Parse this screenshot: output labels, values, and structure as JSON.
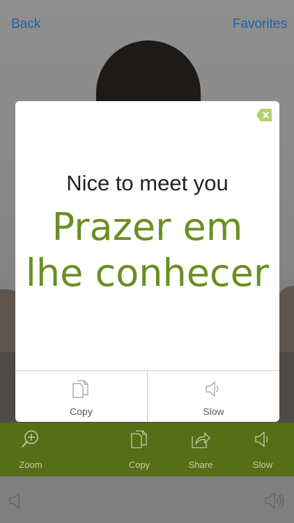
{
  "nav": {
    "back_label": "Back",
    "favorites_label": "Favorites"
  },
  "card": {
    "english": "Nice to meet you",
    "portuguese": "Prazer em lhe conhecer",
    "actions": [
      {
        "label": "Copy",
        "icon": "copy-icon"
      },
      {
        "label": "Slow",
        "icon": "speaker-icon"
      }
    ],
    "close_icon": "close-icon",
    "accent_color": "#6b8e23"
  },
  "toolbar": {
    "color": "#566e16",
    "items": [
      {
        "label": "Zoom",
        "icon": "zoom-in-icon"
      },
      {
        "label": "Copy",
        "icon": "copy-icon"
      },
      {
        "label": "Share",
        "icon": "share-icon"
      },
      {
        "label": "Slow",
        "icon": "speaker-icon"
      }
    ]
  },
  "player": {
    "left_icon": "volume-low-icon",
    "right_icon": "volume-high-icon"
  }
}
